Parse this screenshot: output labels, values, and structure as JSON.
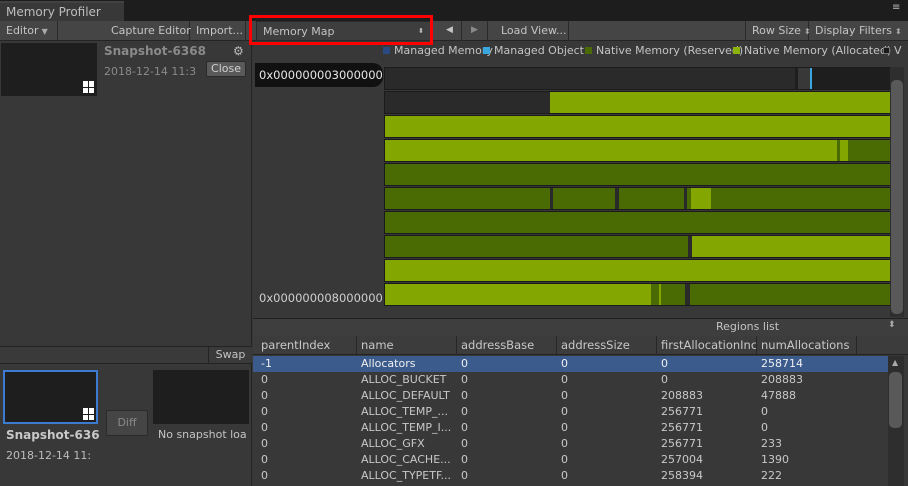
{
  "window": {
    "tab_title": "Memory Profiler",
    "menu_glyph": "≡"
  },
  "toolbar": {
    "editor_label": "Editor",
    "capture_label": "Capture Editor",
    "import_label": "Import...",
    "view_label": "Memory Map",
    "back_glyph": "◀",
    "forward_glyph": "▶",
    "load_view_label": "Load View...",
    "row_size_label": "Row Size",
    "display_filters_label": "Display Filters"
  },
  "snapshot_a": {
    "title": "Snapshot-6368",
    "date": "2018-12-14 11:3",
    "close_label": "Close",
    "settings_glyph": "⚙"
  },
  "snapshot_b": {
    "title": "Snapshot-636",
    "date": "2018-12-14 11:",
    "diff_label": "Diff",
    "empty_text": "No snapshot loa"
  },
  "swap_label": "Swap",
  "legend": [
    {
      "label": "Managed Memory",
      "color": "#2b4a82"
    },
    {
      "label": "Managed Object",
      "color": "#3aa6e0"
    },
    {
      "label": "Native Memory (Reserved)",
      "color": "#4a6a05"
    },
    {
      "label": "Native Memory (Allocated)",
      "color": "#8cb30a"
    },
    {
      "label": "V",
      "color": "#1a1a1a"
    }
  ],
  "map": {
    "address_top": "0x000000003000000",
    "address_bottom": "0x000000008000000",
    "colors": {
      "reserved": "#4a6b04",
      "allocated": "#83a600",
      "empty": "#2a2a2a",
      "managed": "#3aa6e0"
    }
  },
  "regions": {
    "title": "Regions list",
    "columns": [
      "parentIndex",
      "name",
      "addressBase",
      "addressSize",
      "firstAllocationInc",
      "numAllocations"
    ],
    "rows": [
      [
        "-1",
        "Allocators",
        "0",
        "0",
        "0",
        "258714"
      ],
      [
        "0",
        "ALLOC_BUCKET",
        "0",
        "0",
        "0",
        "208883"
      ],
      [
        "0",
        "ALLOC_DEFAULT",
        "0",
        "0",
        "208883",
        "47888"
      ],
      [
        "0",
        "ALLOC_TEMP_...",
        "0",
        "0",
        "256771",
        "0"
      ],
      [
        "0",
        "ALLOC_TEMP_I...",
        "0",
        "0",
        "256771",
        "0"
      ],
      [
        "0",
        "ALLOC_GFX",
        "0",
        "0",
        "256771",
        "233"
      ],
      [
        "0",
        "ALLOC_CACHE...",
        "0",
        "0",
        "257004",
        "1390"
      ],
      [
        "0",
        "ALLOC_TYPETF...",
        "0",
        "0",
        "258394",
        "222"
      ]
    ]
  }
}
